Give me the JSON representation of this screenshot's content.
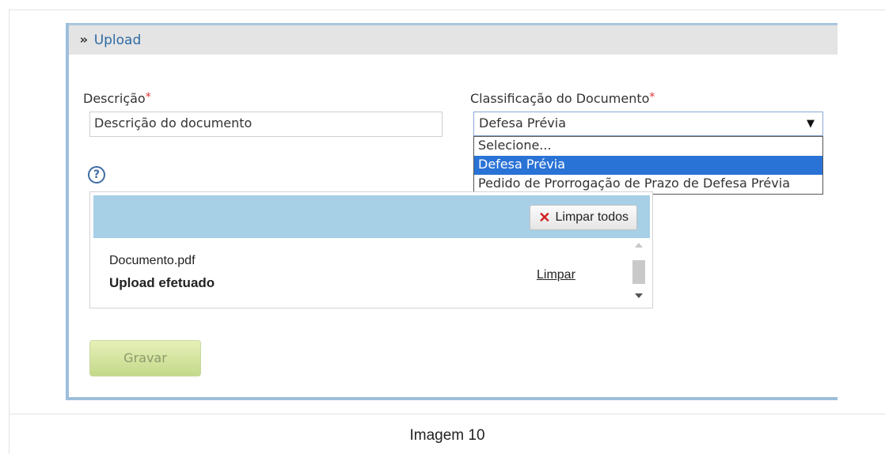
{
  "upload_panel": {
    "title": "Upload"
  },
  "description_field": {
    "label": "Descrição",
    "required_mark": "*",
    "value": "Descrição do documento"
  },
  "classification_field": {
    "label": "Classificação do Documento",
    "required_mark": "*",
    "selected_value": "Defesa Prévia",
    "options": [
      "Selecione...",
      "Defesa Prévia",
      "Pedido de Prorrogação de Prazo de Defesa Prévia"
    ],
    "highlighted_index": 1
  },
  "help": {
    "icon_glyph": "?"
  },
  "uploader": {
    "clear_all_label": "Limpar todos",
    "file_name": "Documento.pdf",
    "file_status": "Upload efetuado",
    "clear_link_label": "Limpar"
  },
  "actions": {
    "save_label": "Gravar"
  },
  "caption": "Imagem 10",
  "colors": {
    "panel_border": "#9ebfda",
    "panel_title": "#2f6aa3",
    "required": "#e03030",
    "dropdown_highlight": "#2a73d6",
    "uploader_toolbar": "#a7cfe6",
    "save_button": "#c4d98a",
    "clear_icon": "#d02020"
  },
  "icons": {
    "collapse": "double-chevron-down-icon",
    "help": "question-circle-icon",
    "clear_all": "x-icon",
    "select": "caret-down-icon"
  }
}
